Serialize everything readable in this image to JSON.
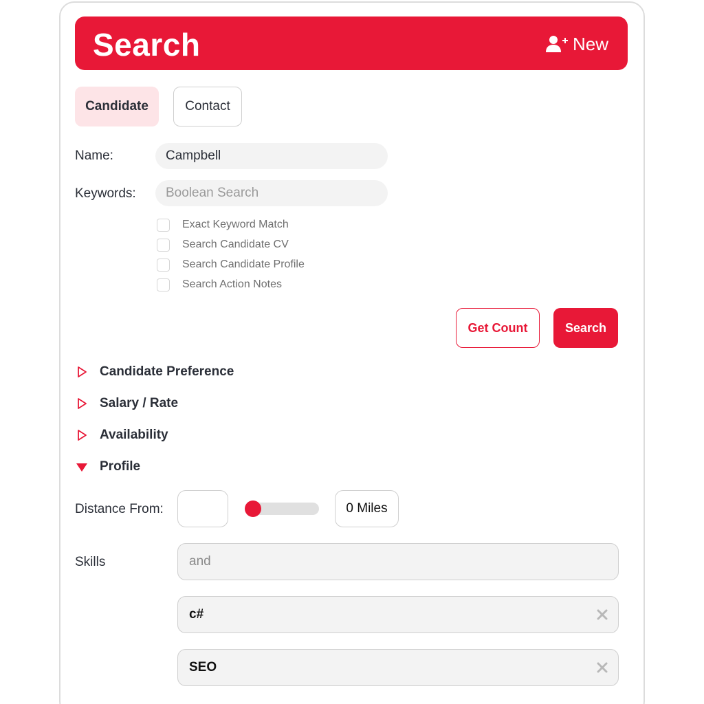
{
  "header": {
    "title": "Search",
    "new_label": "New",
    "new_icon": "add-user-icon",
    "color": "#e81837"
  },
  "tabs": [
    {
      "label": "Candidate",
      "active": true
    },
    {
      "label": "Contact",
      "active": false
    }
  ],
  "form": {
    "name_label": "Name:",
    "name_value": "Campbell",
    "keywords_label": "Keywords:",
    "keywords_placeholder": "Boolean Search",
    "options": [
      {
        "label": "Exact Keyword Match",
        "checked": false
      },
      {
        "label": "Search Candidate CV",
        "checked": false
      },
      {
        "label": "Search Candidate Profile",
        "checked": false
      },
      {
        "label": "Search Action Notes",
        "checked": false
      }
    ]
  },
  "actions": {
    "get_count_label": "Get Count",
    "search_label": "Search"
  },
  "sections": [
    {
      "label": "Candidate Preference",
      "expanded": false
    },
    {
      "label": "Salary / Rate",
      "expanded": false
    },
    {
      "label": "Availability",
      "expanded": false
    },
    {
      "label": "Profile",
      "expanded": true
    }
  ],
  "profile": {
    "distance_label": "Distance From:",
    "distance_value": "",
    "slider_fraction": 0,
    "miles_label": "0 Miles",
    "skills_label": "Skills",
    "skills_placeholder": "and",
    "skills": [
      "c#",
      "SEO"
    ]
  }
}
